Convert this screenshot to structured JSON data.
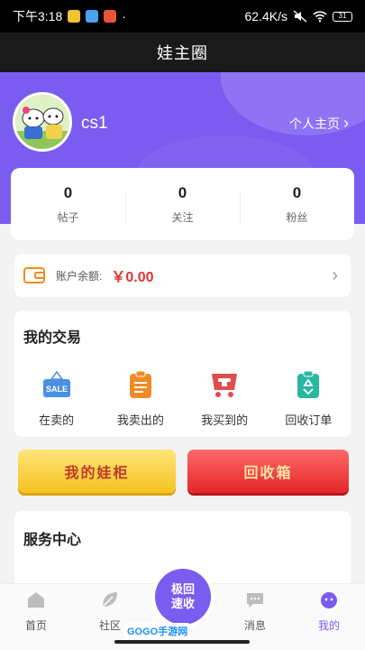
{
  "status_bar": {
    "time": "下午3:18",
    "dot": "·",
    "network_speed": "62.4K/s",
    "battery": "31"
  },
  "nav": {
    "title": "娃主圈"
  },
  "profile": {
    "username": "cs1",
    "homepage_label": "个人主页",
    "chevron": "›"
  },
  "stats": [
    {
      "value": "0",
      "label": "帖子"
    },
    {
      "value": "0",
      "label": "关注"
    },
    {
      "value": "0",
      "label": "粉丝"
    }
  ],
  "balance": {
    "label": "账户余额:",
    "amount": "￥0.00",
    "chevron": "›"
  },
  "trade": {
    "title": "我的交易",
    "items": [
      {
        "label": "在卖的",
        "icon": "sale-tag-icon",
        "color": "#4a90e2"
      },
      {
        "label": "我卖出的",
        "icon": "clipboard-list-icon",
        "color": "#f08a24"
      },
      {
        "label": "我买到的",
        "icon": "shopping-cart-icon",
        "color": "#e24b4b"
      },
      {
        "label": "回收订单",
        "icon": "recycle-clipboard-icon",
        "color": "#26b8a0"
      }
    ],
    "sale_tag_text": "SALE"
  },
  "actions": {
    "cabinet": "我的娃柜",
    "recycle": "回收箱"
  },
  "service": {
    "title": "服务中心"
  },
  "tabs": {
    "home": "首页",
    "community": "社区",
    "center_button": "极回\n速收",
    "messages": "消息",
    "mine": "我的"
  },
  "watermark": "GOGO手游网",
  "colors": {
    "accent": "#7b5cf0",
    "price": "#dd3333"
  }
}
